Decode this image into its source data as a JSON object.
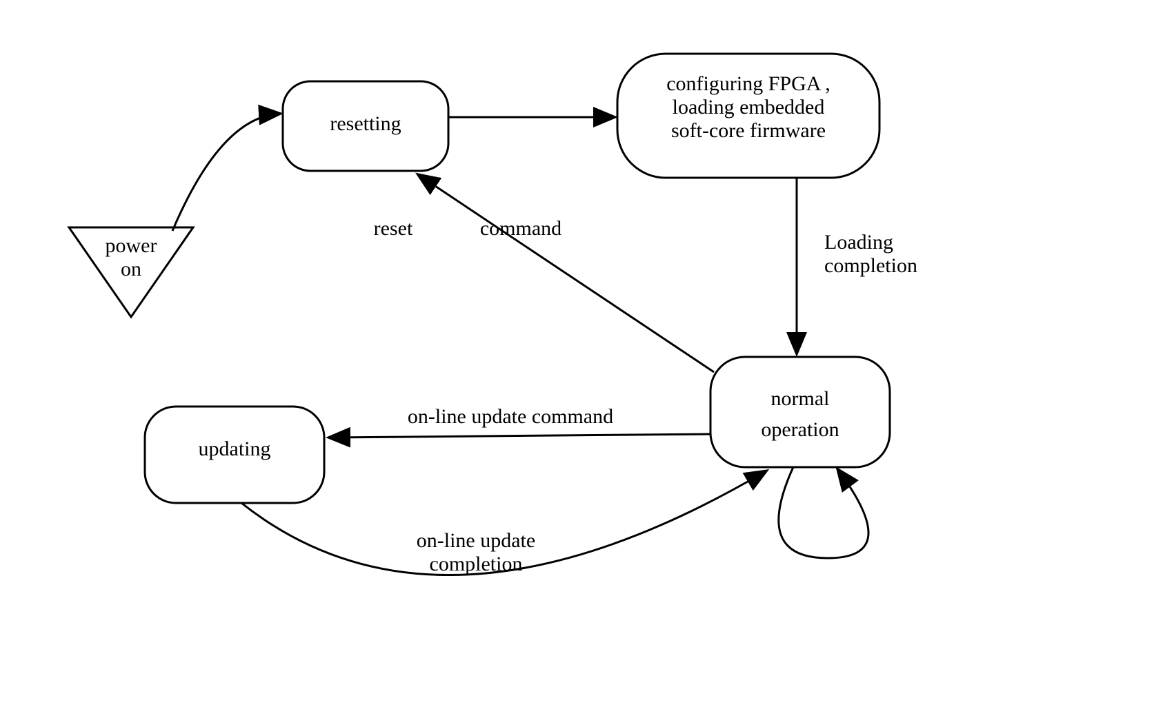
{
  "nodes": {
    "power_on": {
      "label_line1": "power",
      "label_line2": "on"
    },
    "resetting": {
      "label": "resetting"
    },
    "configuring": {
      "label_line1": "configuring FPGA ,",
      "label_line2": "loading embedded",
      "label_line3": "soft-core firmware"
    },
    "normal_operation": {
      "label_line1": "normal",
      "label_line2": "operation"
    },
    "updating": {
      "label": "updating"
    }
  },
  "edges": {
    "reset_command": {
      "label_word1": "reset",
      "label_word2": "command"
    },
    "loading_completion": {
      "label_line1": "Loading",
      "label_line2": "completion"
    },
    "online_update_command": {
      "label": "on-line update command"
    },
    "online_update_completion": {
      "label_line1": "on-line update",
      "label_line2": "completion"
    }
  }
}
